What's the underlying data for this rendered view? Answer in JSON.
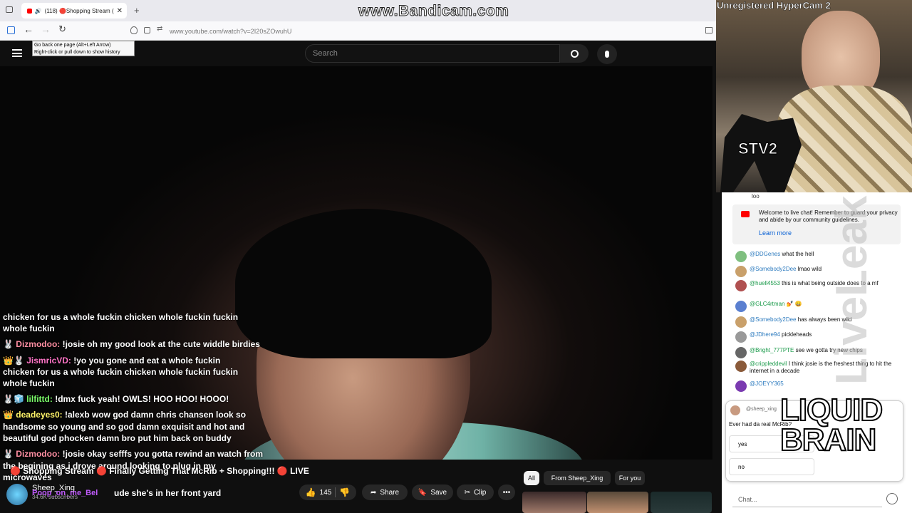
{
  "watermarks": {
    "bandicam": "www.Bandicam.com",
    "hypercam": "Unregistered HyperCam 2",
    "stv": "STV2",
    "liveleak": "LiveLeak",
    "brain": "LIQUID BRAIN"
  },
  "browser": {
    "tab_title": "(118) 🔴Shopping Stream (",
    "url": "www.youtube.com/watch?v=2I20sZOwuhU",
    "tooltip_line1": "Go back one page (Alt+Left Arrow)",
    "tooltip_line2": "Right-click or pull down to show history"
  },
  "header": {
    "search_placeholder": "Search"
  },
  "overlay_chat": [
    {
      "user": "",
      "text": "chicken for us a whole fuckin chicken whole fuckin fuckin"
    },
    {
      "user": "",
      "text": "whole fuckin"
    },
    {
      "user": "Dizmodoo:",
      "text": " !josie oh my good look at the cute widdle birdies"
    },
    {
      "user": "JismricVD:",
      "text": " !yo you gone and eat a whole fuckin"
    },
    {
      "user": "",
      "text": "chicken for us a whole fuckin chicken whole fuckin fuckin"
    },
    {
      "user": "",
      "text": "whole fuckin"
    },
    {
      "user": "lilfittd:",
      "text": " !dmx fuck yeah! OWLS! HOO HOO! HOOO!"
    },
    {
      "user": "deadeyes0:",
      "text": " !alexb wow god damn chris chansen look so"
    },
    {
      "user": "",
      "text": "handsome so young and so god damn exquisit and hot and"
    },
    {
      "user": "",
      "text": "beautiful god phocken damn bro put him back on buddy"
    },
    {
      "user": "Dizmodoo:",
      "text": " !josie okay sefffs you gotta rewind an watch from"
    },
    {
      "user": "",
      "text": "the begining as i drove around looking to plug in my"
    },
    {
      "user": "",
      "text": "microwaves"
    }
  ],
  "video": {
    "title": "🔴 Shopping Stream 🔴 Finally Getting That McRib + Shopping!!! 🔴 LIVE",
    "channel": "Sheep_Xing",
    "subscribers": "34.6K subscribers",
    "overlay_user": "Poop_on_me_Bel",
    "overlay_text": "ude she's in her front yard",
    "like_count": "145",
    "share": "Share",
    "save": "Save",
    "clip": "Clip"
  },
  "chips": [
    "All",
    "From Sheep_Xing",
    "For you"
  ],
  "live_chat": {
    "top_fragment": "loo",
    "welcome": "Welcome to live chat! Remember to guard your privacy and abide by our community guidelines.",
    "learn_more": "Learn more",
    "messages": [
      {
        "user": "@DDGenes",
        "text": "what the hell",
        "color": "#7fbf7f"
      },
      {
        "user": "@Somebody2Dee",
        "text": "lmao wild",
        "color": "#c9a06a"
      },
      {
        "user": "@huell4553",
        "text": "this is what being outside does to a mf",
        "color": "#b05050"
      },
      {
        "user": "@GLC4rtman",
        "text": "💅 😀",
        "color": "#5a7fd0"
      },
      {
        "user": "@Somebody2Dee",
        "text": "has always been wild",
        "color": "#c9a06a"
      },
      {
        "user": "@JDhere94",
        "text": "pickleheads",
        "color": "#999"
      },
      {
        "user": "@Bright_777PTE",
        "text": "see we gotta try new chips",
        "color": "#666"
      },
      {
        "user": "@crippleddevil",
        "text": "I think josie is the freshest thing to hit the internet in a decade",
        "color": "#8a5a3a"
      },
      {
        "user": "@JOEYY365",
        "text": "",
        "color": "#7a3ab0"
      }
    ],
    "poll": {
      "author": "@sheep_xing",
      "question": "Ever had da real McRib?",
      "options": [
        "yes",
        "no"
      ]
    },
    "input_placeholder": "Chat..."
  }
}
